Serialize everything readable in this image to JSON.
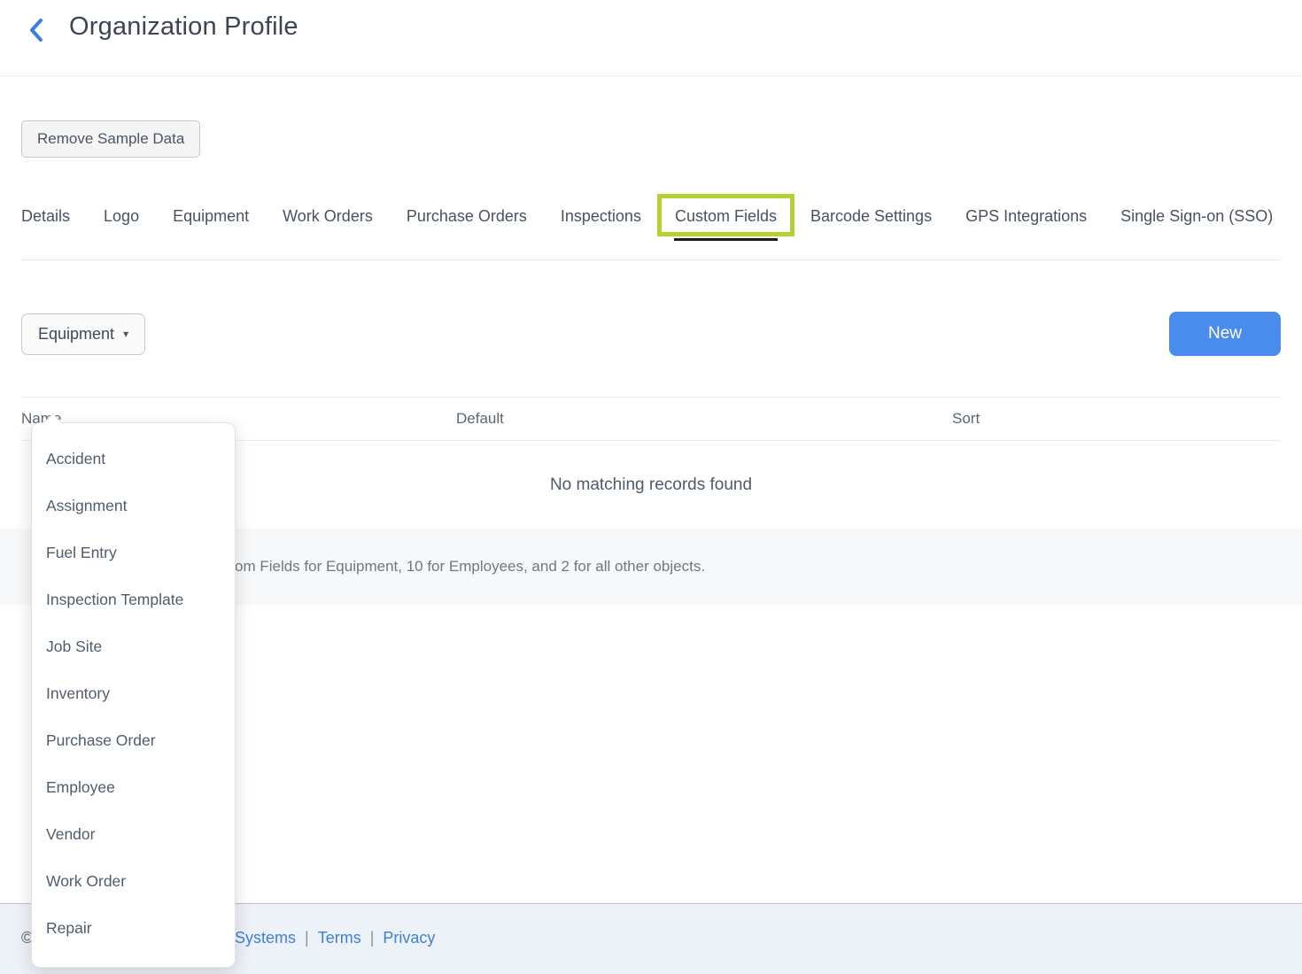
{
  "header": {
    "title": "Organization Profile"
  },
  "actions": {
    "remove_sample_data": "Remove Sample Data",
    "new_button": "New"
  },
  "tabs": [
    {
      "label": "Details"
    },
    {
      "label": "Logo"
    },
    {
      "label": "Equipment"
    },
    {
      "label": "Work Orders"
    },
    {
      "label": "Purchase Orders"
    },
    {
      "label": "Inspections"
    },
    {
      "label": "Custom Fields"
    },
    {
      "label": "Barcode Settings"
    },
    {
      "label": "GPS Integrations"
    },
    {
      "label": "Single Sign-on (SSO)"
    }
  ],
  "active_tab": "Custom Fields",
  "toolbar": {
    "dropdown_label": "Equipment",
    "caret": "▾"
  },
  "dropdown": {
    "items": [
      "Accident",
      "Assignment",
      "Fuel Entry",
      "Inspection Template",
      "Job Site",
      "Inventory",
      "Purchase Order",
      "Employee",
      "Vendor",
      "Work Order",
      "Repair"
    ]
  },
  "table": {
    "columns": [
      "Name",
      "Default",
      "Sort"
    ],
    "empty_text": "No matching records found"
  },
  "info_bar": {
    "text": "om Fields for Equipment, 10 for Employees, and 2 for all other objects."
  },
  "footer": {
    "copyright": "©",
    "company_link": "Systems",
    "separator": "|",
    "links": [
      "Terms",
      "Privacy"
    ]
  },
  "colors": {
    "accent_blue": "#4a8ceb",
    "link_blue": "#3d7fd9",
    "highlight_green": "#b2d234",
    "active_underline": "#1b1b1b"
  }
}
